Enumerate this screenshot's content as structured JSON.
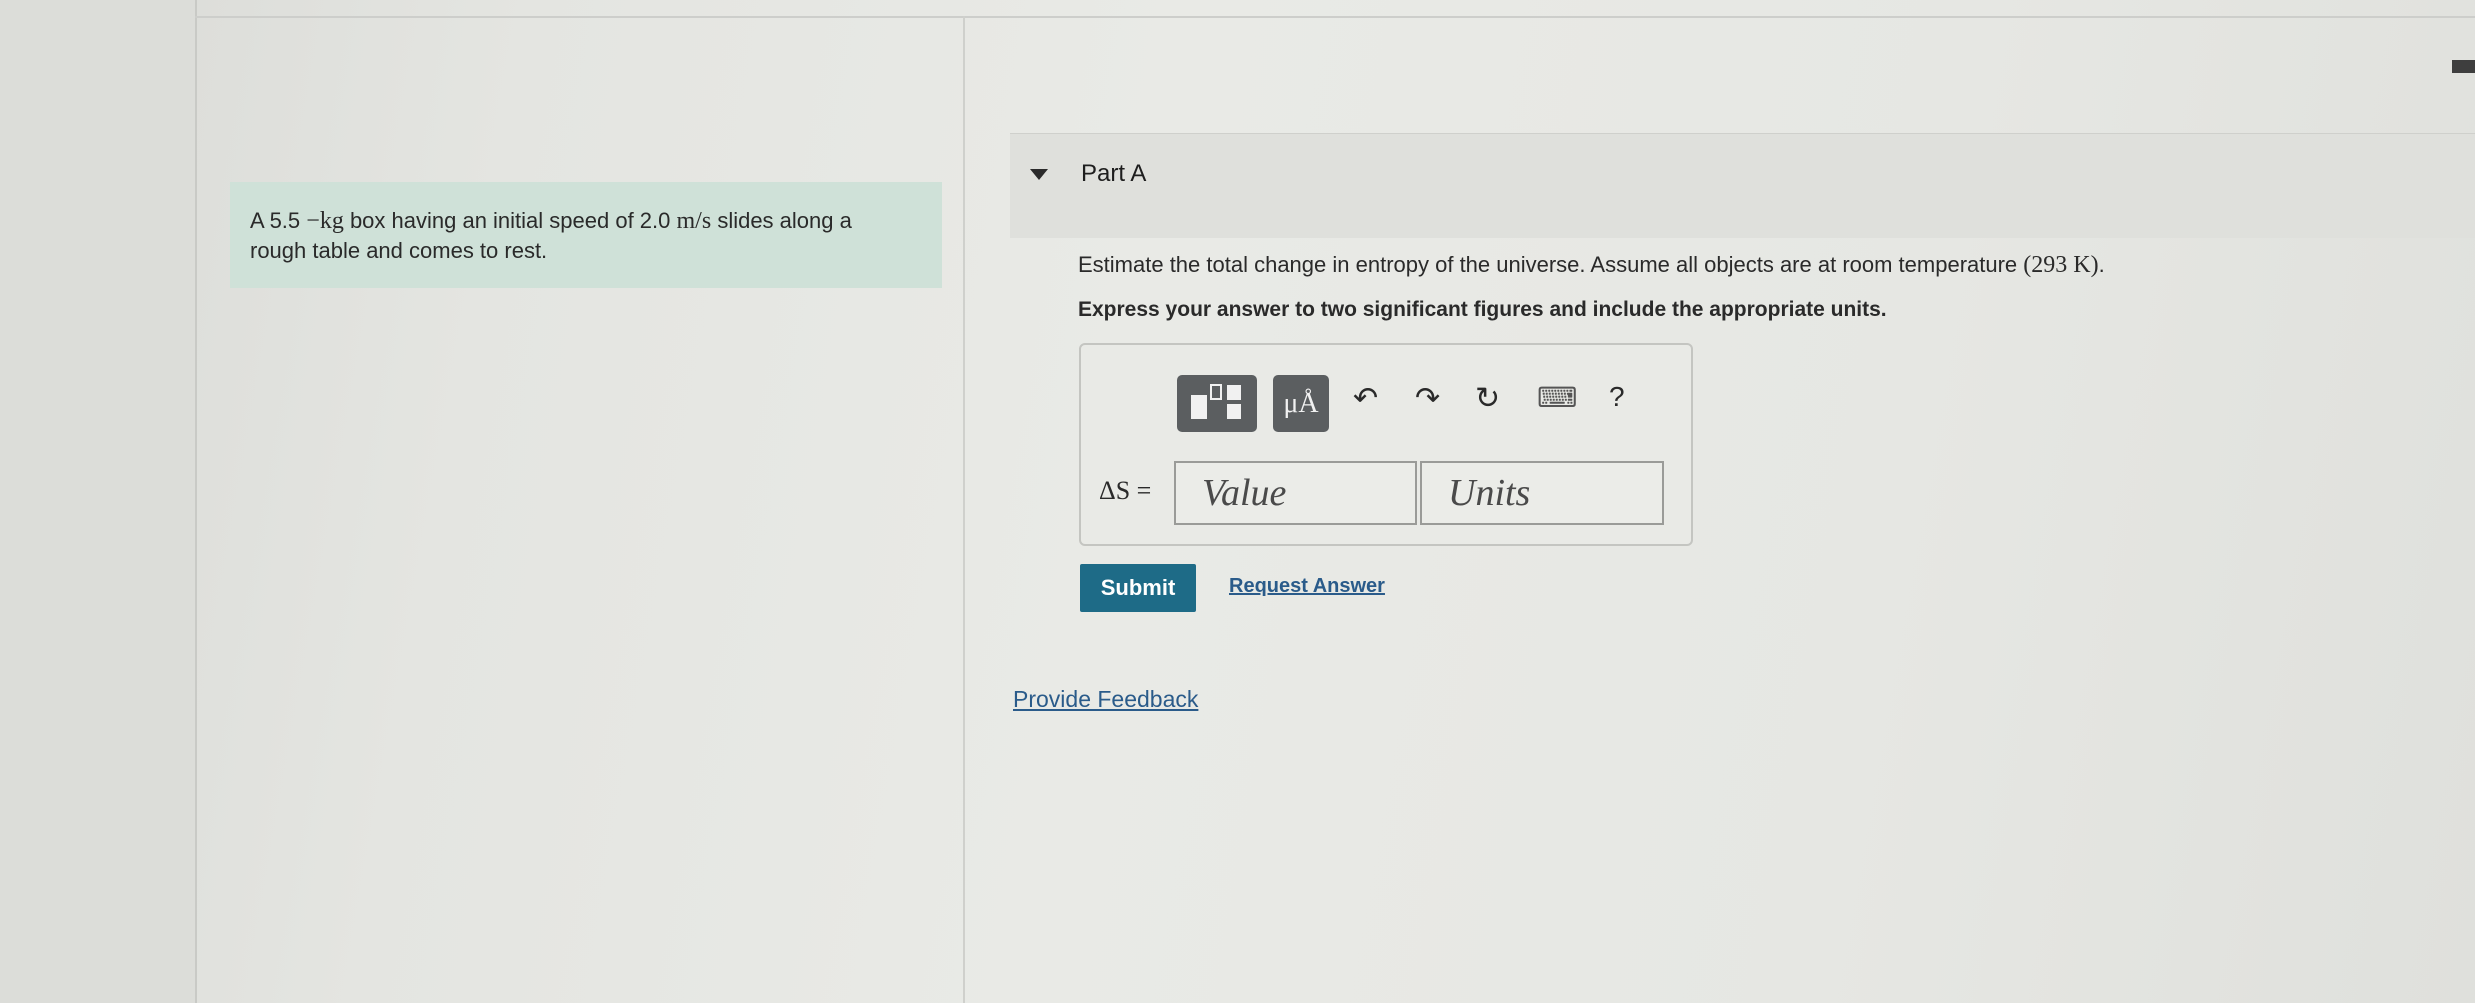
{
  "problem": {
    "text_before": "A 5.5 ",
    "mass_unit": "−kg",
    "text_mid": " box having an initial speed of 2.0 ",
    "speed_unit": "m/s",
    "text_after_line1": " slides along a",
    "line2": "rough table and comes to rest."
  },
  "part": {
    "title": "Part A"
  },
  "question": {
    "text": "Estimate the total change in entropy of the universe. Assume all objects are at room temperature ",
    "temperature": "(293 K)",
    "end": "."
  },
  "instruction": "Express your answer to two significant figures and include the appropriate units.",
  "toolbar": {
    "mu_label": "μÅ",
    "undo": "↶",
    "redo": "↷",
    "reset": "↻",
    "keyboard": "⌨",
    "help": "?"
  },
  "answer": {
    "label": "ΔS =",
    "value_placeholder": "Value",
    "units_placeholder": "Units"
  },
  "actions": {
    "submit": "Submit",
    "request_answer": "Request Answer"
  },
  "feedback_link": "Provide Feedback"
}
